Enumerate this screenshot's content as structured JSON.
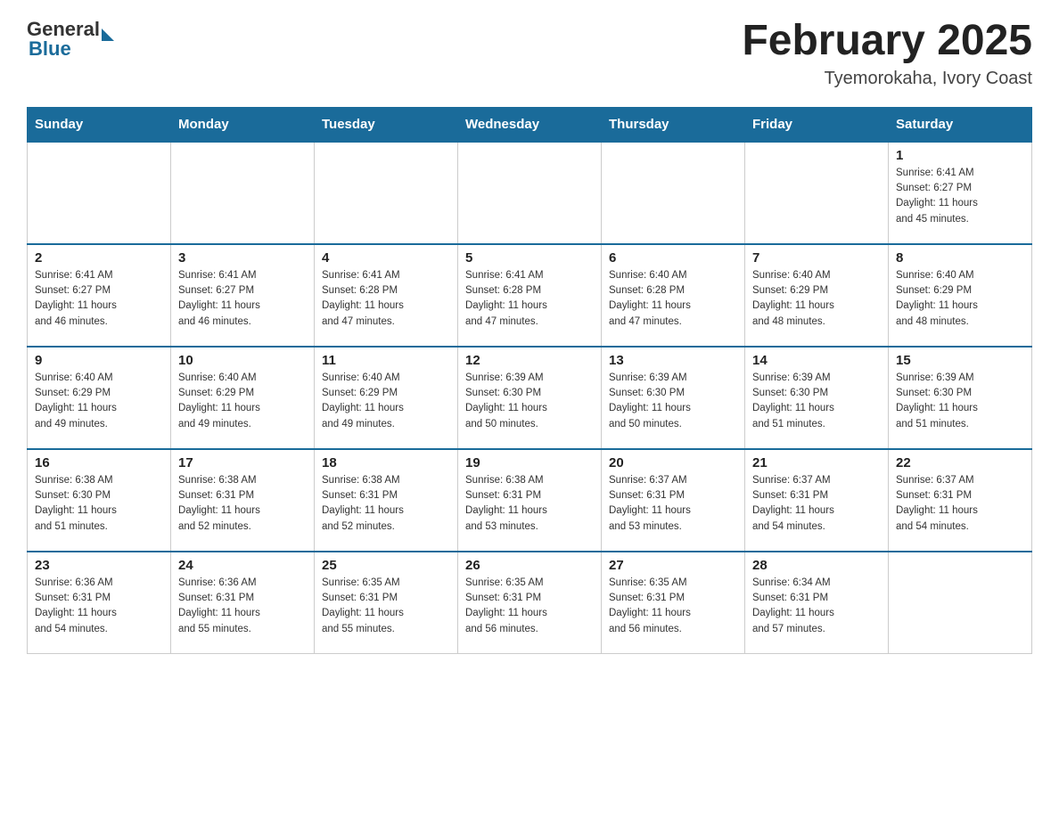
{
  "logo": {
    "general": "General",
    "blue": "Blue",
    "arrow_color": "#1a6b9a"
  },
  "title": {
    "month_year": "February 2025",
    "location": "Tyemorokaha, Ivory Coast"
  },
  "weekdays": [
    "Sunday",
    "Monday",
    "Tuesday",
    "Wednesday",
    "Thursday",
    "Friday",
    "Saturday"
  ],
  "weeks": [
    [
      {
        "day": "",
        "info": ""
      },
      {
        "day": "",
        "info": ""
      },
      {
        "day": "",
        "info": ""
      },
      {
        "day": "",
        "info": ""
      },
      {
        "day": "",
        "info": ""
      },
      {
        "day": "",
        "info": ""
      },
      {
        "day": "1",
        "info": "Sunrise: 6:41 AM\nSunset: 6:27 PM\nDaylight: 11 hours\nand 45 minutes."
      }
    ],
    [
      {
        "day": "2",
        "info": "Sunrise: 6:41 AM\nSunset: 6:27 PM\nDaylight: 11 hours\nand 46 minutes."
      },
      {
        "day": "3",
        "info": "Sunrise: 6:41 AM\nSunset: 6:27 PM\nDaylight: 11 hours\nand 46 minutes."
      },
      {
        "day": "4",
        "info": "Sunrise: 6:41 AM\nSunset: 6:28 PM\nDaylight: 11 hours\nand 47 minutes."
      },
      {
        "day": "5",
        "info": "Sunrise: 6:41 AM\nSunset: 6:28 PM\nDaylight: 11 hours\nand 47 minutes."
      },
      {
        "day": "6",
        "info": "Sunrise: 6:40 AM\nSunset: 6:28 PM\nDaylight: 11 hours\nand 47 minutes."
      },
      {
        "day": "7",
        "info": "Sunrise: 6:40 AM\nSunset: 6:29 PM\nDaylight: 11 hours\nand 48 minutes."
      },
      {
        "day": "8",
        "info": "Sunrise: 6:40 AM\nSunset: 6:29 PM\nDaylight: 11 hours\nand 48 minutes."
      }
    ],
    [
      {
        "day": "9",
        "info": "Sunrise: 6:40 AM\nSunset: 6:29 PM\nDaylight: 11 hours\nand 49 minutes."
      },
      {
        "day": "10",
        "info": "Sunrise: 6:40 AM\nSunset: 6:29 PM\nDaylight: 11 hours\nand 49 minutes."
      },
      {
        "day": "11",
        "info": "Sunrise: 6:40 AM\nSunset: 6:29 PM\nDaylight: 11 hours\nand 49 minutes."
      },
      {
        "day": "12",
        "info": "Sunrise: 6:39 AM\nSunset: 6:30 PM\nDaylight: 11 hours\nand 50 minutes."
      },
      {
        "day": "13",
        "info": "Sunrise: 6:39 AM\nSunset: 6:30 PM\nDaylight: 11 hours\nand 50 minutes."
      },
      {
        "day": "14",
        "info": "Sunrise: 6:39 AM\nSunset: 6:30 PM\nDaylight: 11 hours\nand 51 minutes."
      },
      {
        "day": "15",
        "info": "Sunrise: 6:39 AM\nSunset: 6:30 PM\nDaylight: 11 hours\nand 51 minutes."
      }
    ],
    [
      {
        "day": "16",
        "info": "Sunrise: 6:38 AM\nSunset: 6:30 PM\nDaylight: 11 hours\nand 51 minutes."
      },
      {
        "day": "17",
        "info": "Sunrise: 6:38 AM\nSunset: 6:31 PM\nDaylight: 11 hours\nand 52 minutes."
      },
      {
        "day": "18",
        "info": "Sunrise: 6:38 AM\nSunset: 6:31 PM\nDaylight: 11 hours\nand 52 minutes."
      },
      {
        "day": "19",
        "info": "Sunrise: 6:38 AM\nSunset: 6:31 PM\nDaylight: 11 hours\nand 53 minutes."
      },
      {
        "day": "20",
        "info": "Sunrise: 6:37 AM\nSunset: 6:31 PM\nDaylight: 11 hours\nand 53 minutes."
      },
      {
        "day": "21",
        "info": "Sunrise: 6:37 AM\nSunset: 6:31 PM\nDaylight: 11 hours\nand 54 minutes."
      },
      {
        "day": "22",
        "info": "Sunrise: 6:37 AM\nSunset: 6:31 PM\nDaylight: 11 hours\nand 54 minutes."
      }
    ],
    [
      {
        "day": "23",
        "info": "Sunrise: 6:36 AM\nSunset: 6:31 PM\nDaylight: 11 hours\nand 54 minutes."
      },
      {
        "day": "24",
        "info": "Sunrise: 6:36 AM\nSunset: 6:31 PM\nDaylight: 11 hours\nand 55 minutes."
      },
      {
        "day": "25",
        "info": "Sunrise: 6:35 AM\nSunset: 6:31 PM\nDaylight: 11 hours\nand 55 minutes."
      },
      {
        "day": "26",
        "info": "Sunrise: 6:35 AM\nSunset: 6:31 PM\nDaylight: 11 hours\nand 56 minutes."
      },
      {
        "day": "27",
        "info": "Sunrise: 6:35 AM\nSunset: 6:31 PM\nDaylight: 11 hours\nand 56 minutes."
      },
      {
        "day": "28",
        "info": "Sunrise: 6:34 AM\nSunset: 6:31 PM\nDaylight: 11 hours\nand 57 minutes."
      },
      {
        "day": "",
        "info": ""
      }
    ]
  ]
}
